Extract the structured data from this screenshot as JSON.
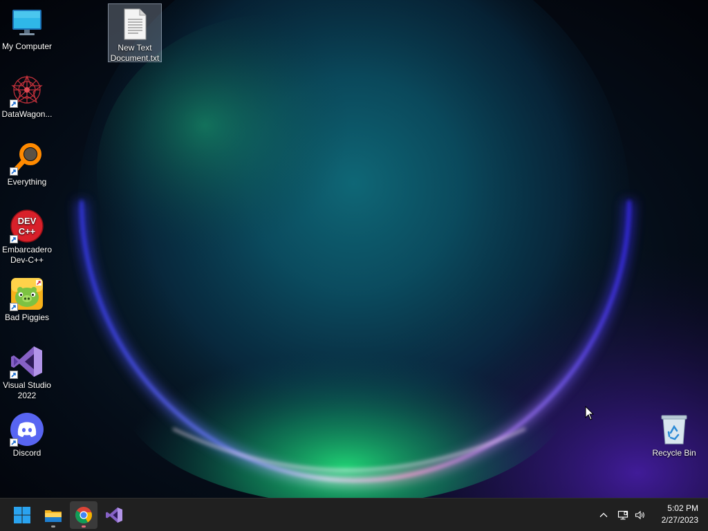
{
  "desktop": {
    "icons": [
      {
        "label": "My Computer",
        "icon": "monitor-icon",
        "shortcut": false
      },
      {
        "label": "DataWagon...",
        "icon": "datawagon-icon",
        "shortcut": true
      },
      {
        "label": "Everything",
        "icon": "magnifier-icon",
        "shortcut": true
      },
      {
        "label": "Embarcadero Dev-C++",
        "icon": "devcpp-icon",
        "shortcut": true
      },
      {
        "label": "Bad Piggies",
        "icon": "bad-piggies-icon",
        "shortcut": true
      },
      {
        "label": "Visual Studio 2022",
        "icon": "visual-studio-icon",
        "shortcut": true
      },
      {
        "label": "Discord",
        "icon": "discord-icon",
        "shortcut": true
      }
    ],
    "file_icon": {
      "label": "New Text Document.txt",
      "icon": "text-file-icon",
      "selected": true
    },
    "recycle_bin": {
      "label": "Recycle Bin",
      "icon": "recycle-bin-icon"
    }
  },
  "taskbar": {
    "pinned": [
      {
        "name": "Start",
        "icon": "windows-start-icon",
        "running": false
      },
      {
        "name": "File Explorer",
        "icon": "file-explorer-icon",
        "running": true
      },
      {
        "name": "Google Chrome",
        "icon": "chrome-icon",
        "running": true,
        "active": true
      },
      {
        "name": "Visual Studio",
        "icon": "visual-studio-icon",
        "running": false
      }
    ],
    "tray": {
      "icons": [
        "chevron-up-icon",
        "network-icon",
        "speaker-icon"
      ]
    },
    "clock": {
      "time": "5:02 PM",
      "date": "2/27/2023"
    }
  },
  "colors": {
    "taskbar_bg": "#202020",
    "accent": "#0078d4"
  }
}
